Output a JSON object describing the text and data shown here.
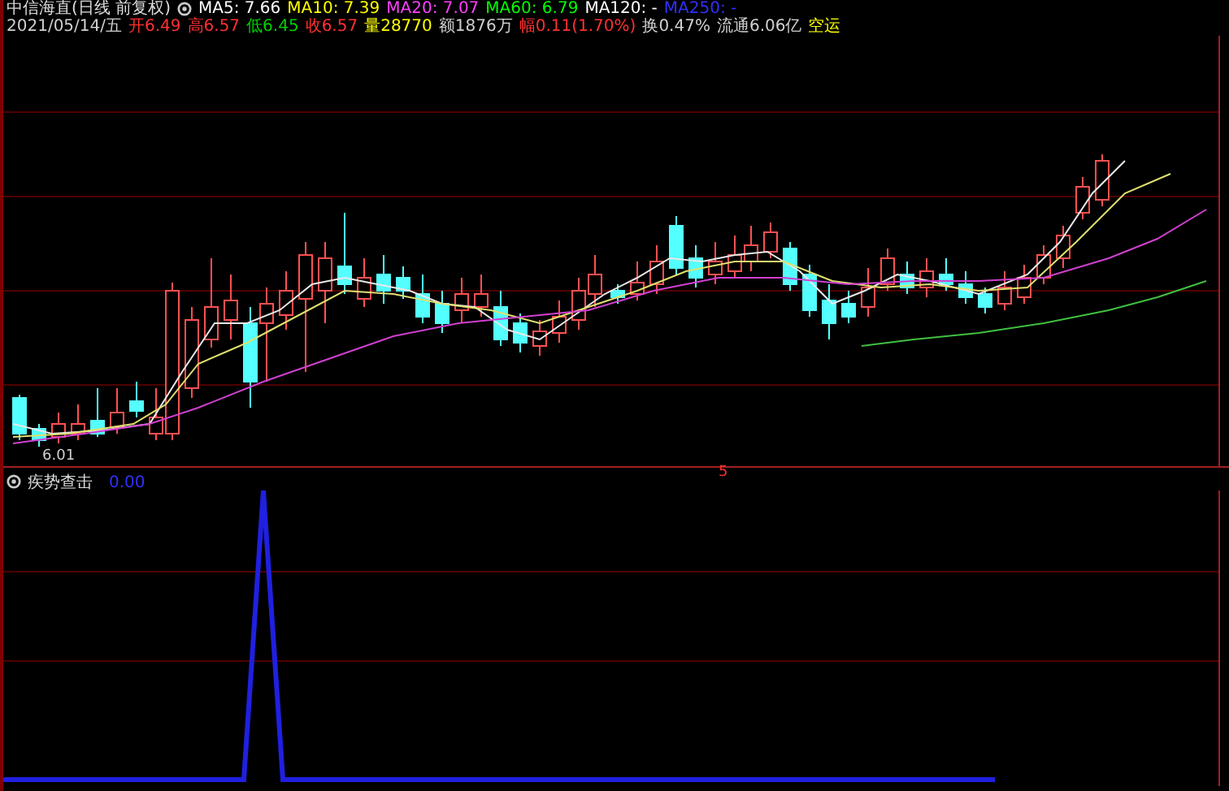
{
  "header": {
    "title": "中信海直(日线 前复权)",
    "ma": [
      {
        "label": "MA5: 7.66",
        "color": "#ffffff"
      },
      {
        "label": "MA10: 7.39",
        "color": "#ffff00"
      },
      {
        "label": "MA20: 7.07",
        "color": "#ff40ff"
      },
      {
        "label": "MA60: 6.79",
        "color": "#00ff00"
      },
      {
        "label": "MA120: -",
        "color": "#ffffff"
      },
      {
        "label": "MA250: -",
        "color": "#3030ff"
      }
    ]
  },
  "quote": [
    {
      "label": "2021/05/14/五",
      "color": "#d0d0d0"
    },
    {
      "label": "开6.49",
      "color": "#ff3030"
    },
    {
      "label": "高6.57",
      "color": "#ff3030"
    },
    {
      "label": "低6.45",
      "color": "#00d000"
    },
    {
      "label": "收6.57",
      "color": "#ff3030"
    },
    {
      "label": "量28770",
      "color": "#ffff00"
    },
    {
      "label": "额1876万",
      "color": "#d0d0d0"
    },
    {
      "label": "幅0.11(1.70%)",
      "color": "#ff3030"
    },
    {
      "label": "换0.47%",
      "color": "#d0d0d0"
    },
    {
      "label": "流通6.06亿",
      "color": "#d0d0d0"
    },
    {
      "label": "空运",
      "color": "#ffff00"
    }
  ],
  "chart": {
    "low_label": "6.01",
    "marker": "5"
  },
  "indicator": {
    "title": "疾势查击",
    "value": "0.00"
  }
}
